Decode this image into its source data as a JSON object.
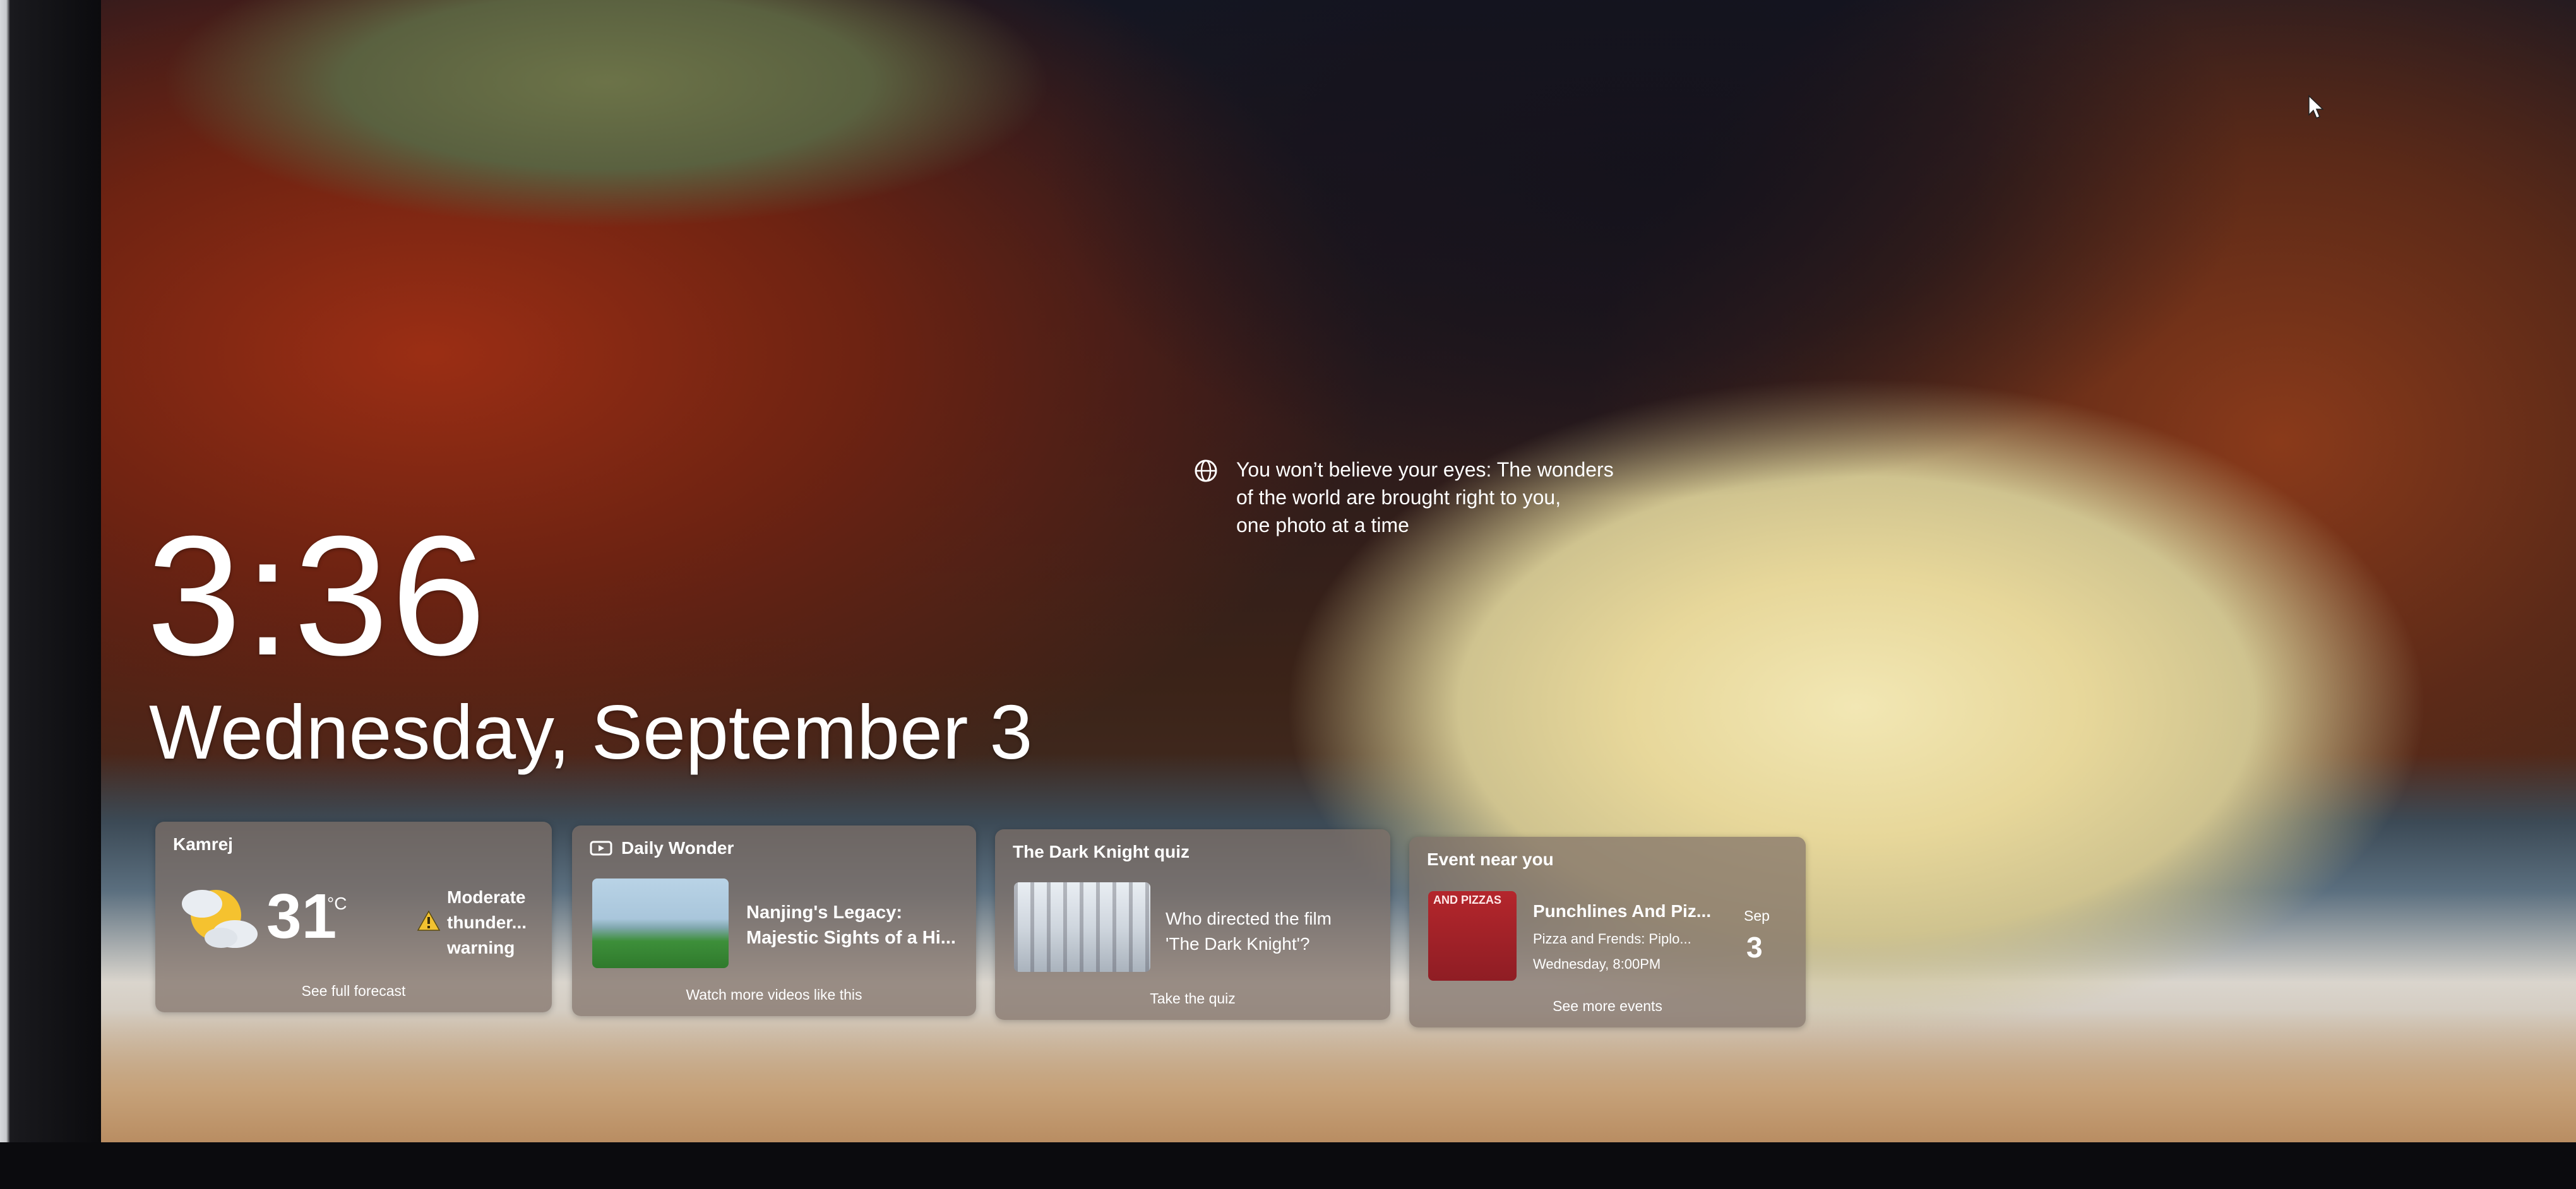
{
  "lockscreen": {
    "time": "3:36",
    "date": "Wednesday, September 3",
    "attribution": {
      "icon": "globe-icon",
      "lines": [
        "You won’t believe your eyes: The wonders",
        "of the world are brought right to you,",
        "one photo at a time"
      ]
    }
  },
  "widgets": {
    "weather": {
      "location": "Kamrej",
      "temperature": "31",
      "unit": "°C",
      "condition_icon": "partly-cloudy-icon",
      "warning_icon": "warning-icon",
      "warning_lines": [
        "Moderate",
        "thunder...",
        "warning"
      ],
      "footer": "See full forecast"
    },
    "daily_wonder": {
      "title": "Daily Wonder",
      "icon": "video-icon",
      "headline_lines": [
        "Nanjing's Legacy:",
        "Majestic Sights of a Hi..."
      ],
      "footer": "Watch more videos like this"
    },
    "quiz": {
      "title": "The Dark Knight quiz",
      "question_lines": [
        "Who directed the film",
        "'The Dark Knight'?"
      ],
      "footer": "Take the quiz"
    },
    "event": {
      "title": "Event near you",
      "poster_text": "AND PIZZAS",
      "event_name": "Punchlines And Piz...",
      "subtitle": "Pizza and Frends: Piplo...",
      "time": "Wednesday, 8:00PM",
      "month": "Sep",
      "day": "3",
      "footer": "See more events"
    }
  },
  "colors": {
    "card_background": "#807068",
    "text": "#ffffff",
    "warning": "#f2c230"
  }
}
